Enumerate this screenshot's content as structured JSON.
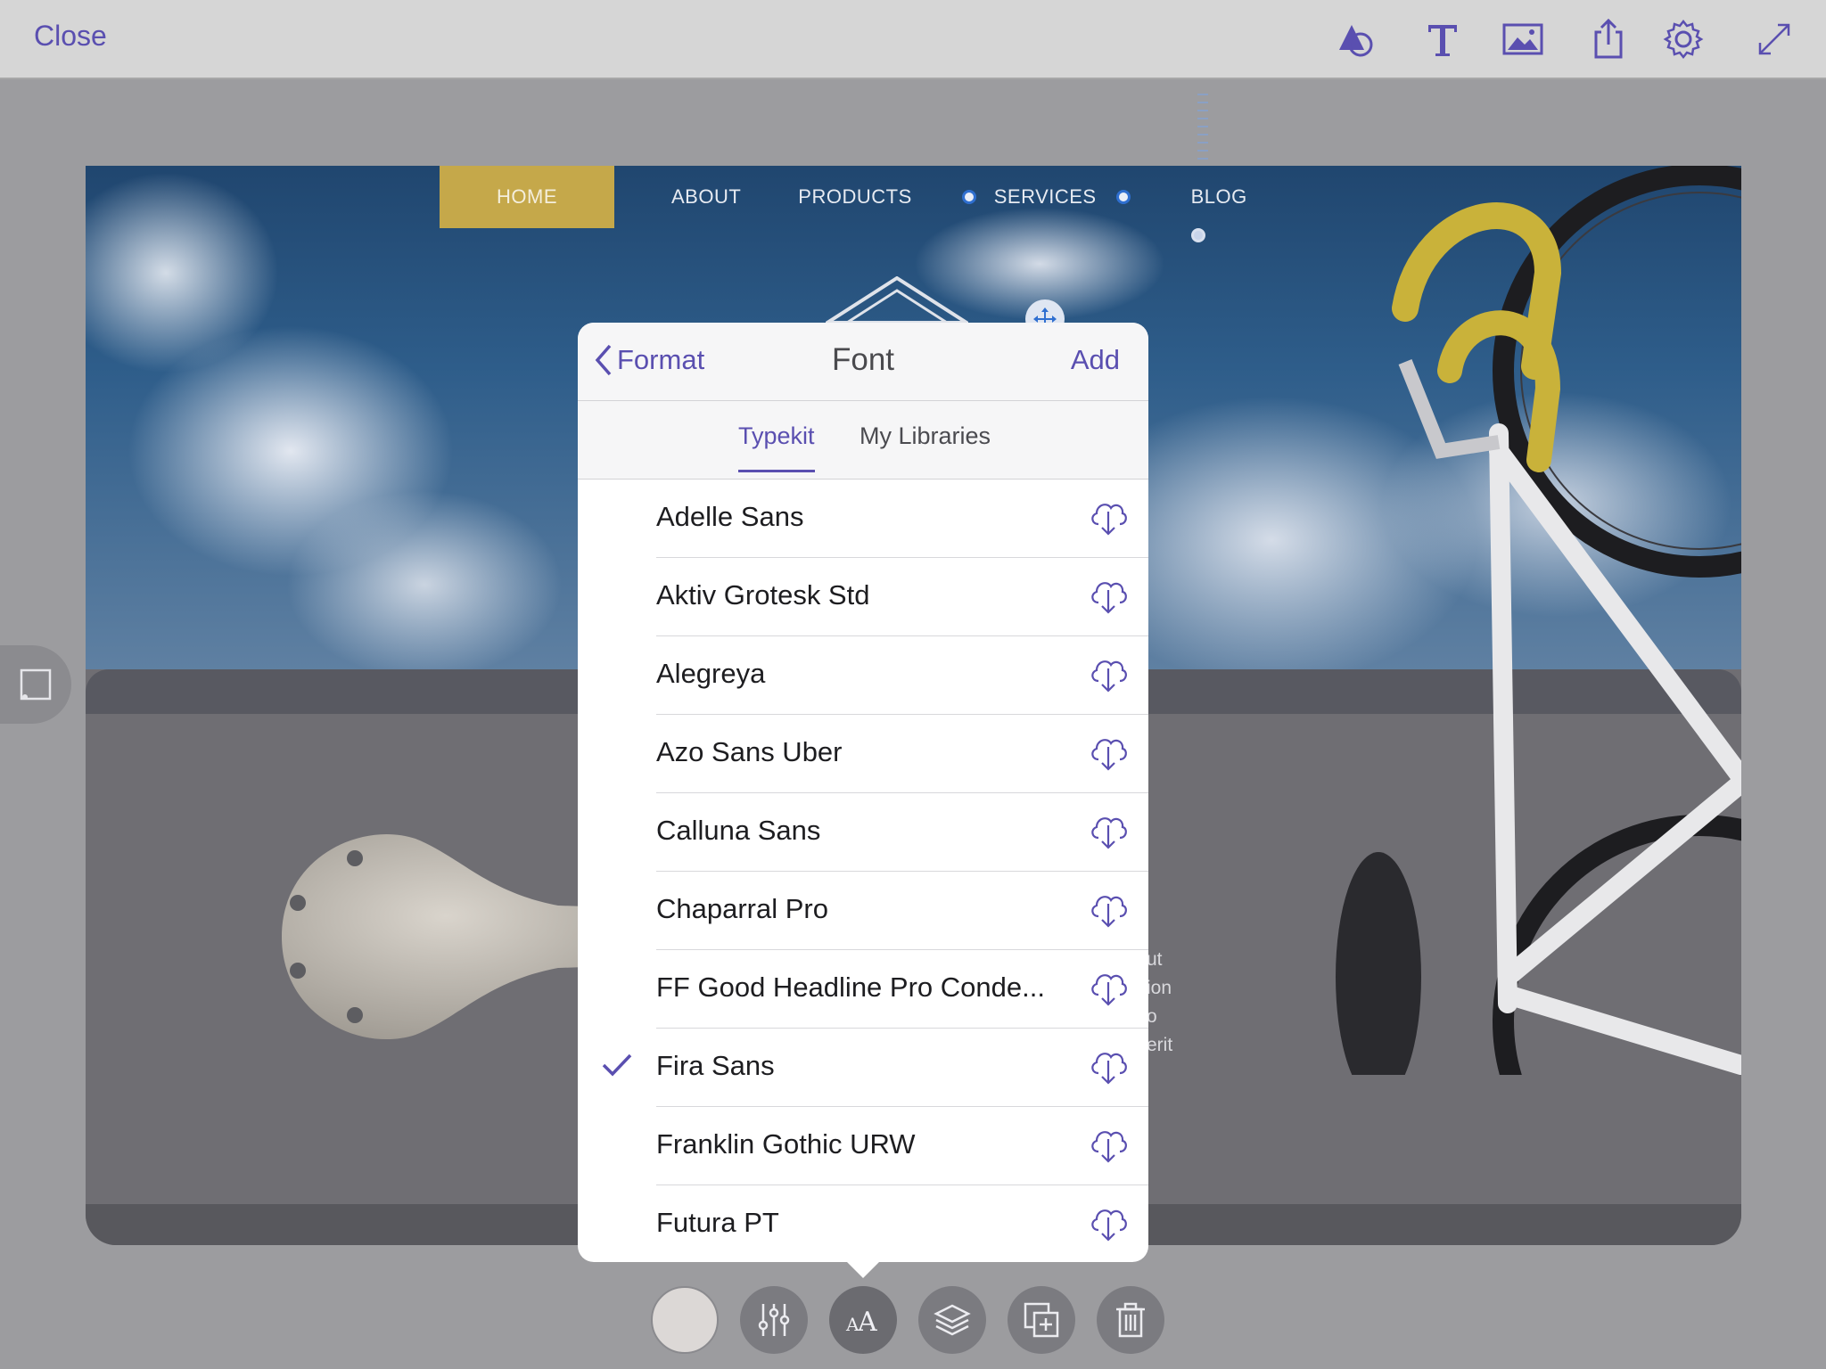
{
  "toolbar": {
    "close_label": "Close",
    "tools": [
      "shapes-icon",
      "text-icon",
      "image-icon",
      "share-icon",
      "settings-icon",
      "fullscreen-icon"
    ],
    "accent_color": "#5a4fb0"
  },
  "artboard": {
    "nav": {
      "home": "HOME",
      "about": "ABOUT",
      "products": "PRODUCTS",
      "services": "SERVICES",
      "blog": "BLOG"
    },
    "body_fragments": [
      "ut",
      "ion",
      "o",
      "erit"
    ]
  },
  "popover": {
    "back_label": "Format",
    "title": "Font",
    "add_label": "Add",
    "tabs": {
      "typekit": "Typekit",
      "my_libraries": "My Libraries",
      "active": "Typekit"
    },
    "fonts": [
      {
        "name": "Adelle Sans",
        "selected": false
      },
      {
        "name": "Aktiv Grotesk Std",
        "selected": false
      },
      {
        "name": "Alegreya",
        "selected": false
      },
      {
        "name": "Azo Sans Uber",
        "selected": false
      },
      {
        "name": "Calluna Sans",
        "selected": false
      },
      {
        "name": "Chaparral Pro",
        "selected": false
      },
      {
        "name": "FF Good Headline Pro Conde...",
        "selected": false
      },
      {
        "name": "Fira Sans",
        "selected": true
      },
      {
        "name": "Franklin Gothic URW",
        "selected": false
      },
      {
        "name": "Futura PT",
        "selected": false
      }
    ]
  },
  "bottom_toolbar": {
    "tools": [
      "color-swatch",
      "adjust-sliders-icon",
      "font-aa-icon",
      "layers-icon",
      "duplicate-icon",
      "trash-icon"
    ],
    "active": "font-aa-icon"
  }
}
